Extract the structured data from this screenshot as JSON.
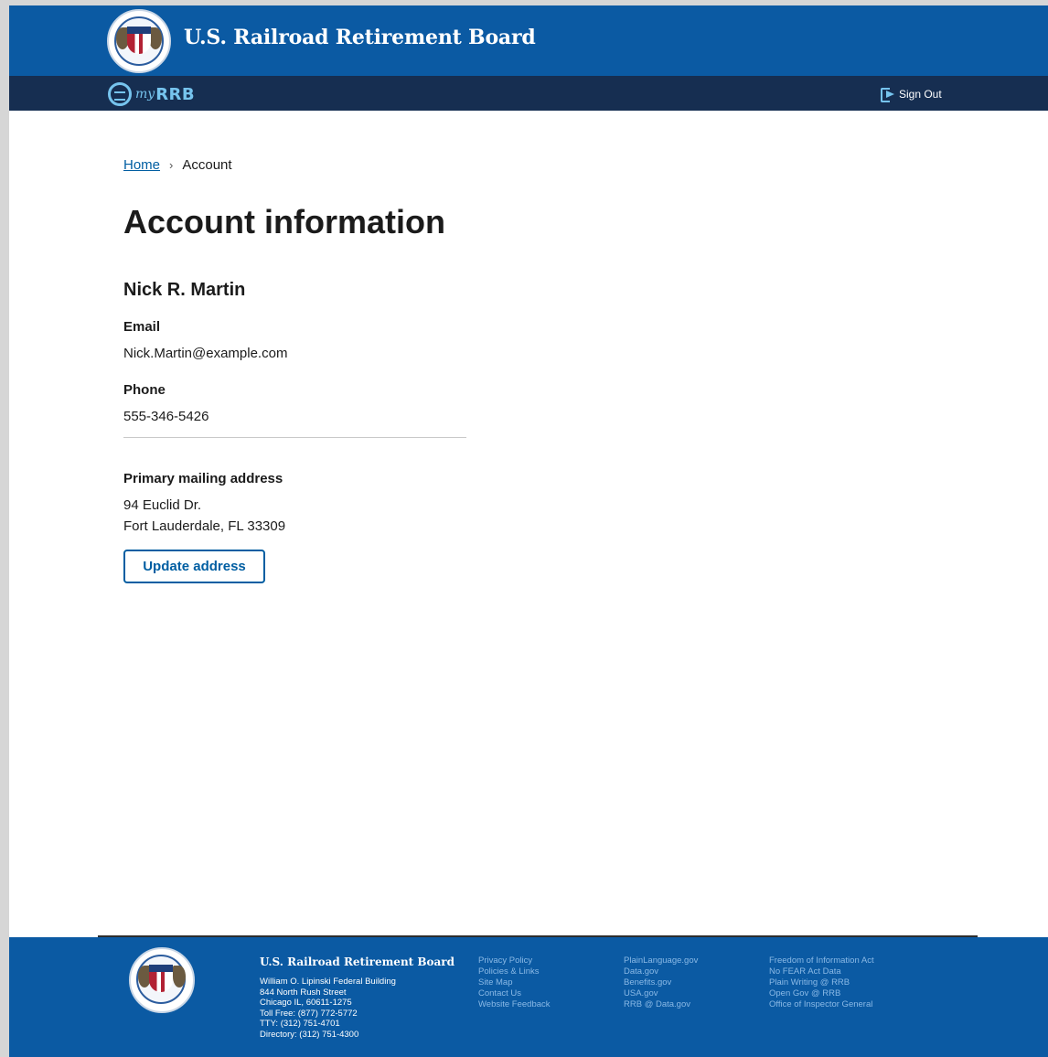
{
  "header": {
    "agency_title": "U.S. Railroad Retirement Board",
    "app_logo_prefix": "my",
    "app_logo_name": "RRB",
    "sign_out_label": "Sign Out"
  },
  "breadcrumb": {
    "home": "Home",
    "separator": "›",
    "current": "Account"
  },
  "main": {
    "title": "Account information",
    "user_name": "Nick R. Martin",
    "email_label": "Email",
    "email_value": "Nick.Martin@example.com",
    "phone_label": "Phone",
    "phone_value": "555-346-5426",
    "address_label": "Primary mailing address",
    "address_line1": "94 Euclid Dr.",
    "address_line2": "Fort Lauderdale, FL 33309",
    "update_button": "Update address"
  },
  "footer": {
    "title": "U.S. Railroad Retirement Board",
    "address": [
      "William O. Lipinski Federal Building",
      "844 North Rush Street",
      "Chicago IL, 60611-1275",
      "Toll Free: (877) 772-5772",
      "TTY: (312) 751-4701",
      "Directory: (312) 751-4300"
    ],
    "links_col1": [
      "Privacy Policy",
      "Policies & Links",
      "Site Map",
      "Contact Us",
      "Website Feedback"
    ],
    "links_col2": [
      "PlainLanguage.gov",
      "Data.gov",
      "Benefits.gov",
      "USA.gov",
      "RRB @ Data.gov"
    ],
    "links_col3": [
      "Freedom of Information Act",
      "No FEAR Act Data",
      "Plain Writing @ RRB",
      "Open Gov @ RRB",
      "Office of Inspector General"
    ]
  },
  "colors": {
    "banner_blue": "#0b5aa3",
    "nav_navy": "#162e51",
    "link_blue": "#005ea2",
    "accent_cyan": "#76c4ee"
  }
}
